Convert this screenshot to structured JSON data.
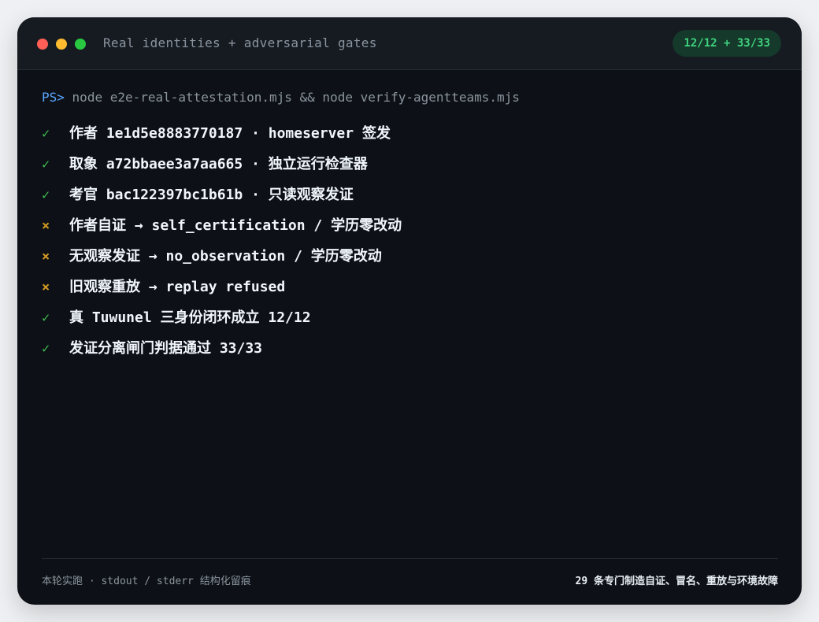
{
  "window": {
    "title": "Real identities + adversarial gates",
    "badge": "12/12 + 33/33"
  },
  "terminal": {
    "prompt": "PS>",
    "command": "node e2e-real-attestation.mjs && node verify-agentteams.mjs",
    "lines": [
      {
        "status": "pass",
        "mark": "✓",
        "text": "作者  1e1d5e8883770187 · homeserver 签发"
      },
      {
        "status": "pass",
        "mark": "✓",
        "text": "取象  a72bbaee3a7aa665 · 独立运行检查器"
      },
      {
        "status": "pass",
        "mark": "✓",
        "text": "考官  bac122397bc1b61b · 只读观察发证"
      },
      {
        "status": "fail",
        "mark": "×",
        "text": "作者自证 → self_certification / 学历零改动"
      },
      {
        "status": "fail",
        "mark": "×",
        "text": "无观察发证 → no_observation / 学历零改动"
      },
      {
        "status": "fail",
        "mark": "×",
        "text": "旧观察重放 → replay refused"
      },
      {
        "status": "pass",
        "mark": "✓",
        "text": "真 Tuwunel 三身份闭环成立 12/12"
      },
      {
        "status": "pass",
        "mark": "✓",
        "text": "发证分离闸门判据通过 33/33"
      }
    ]
  },
  "footer": {
    "left": "本轮实跑 · stdout / stderr 结构化留痕",
    "right": "29 条专门制造自证、冒名、重放与环境故障"
  },
  "colors": {
    "background": "#0d1117",
    "pass": "#3fb950",
    "fail": "#d29922",
    "prompt": "#58a6ff",
    "badge_bg": "#15392a",
    "badge_fg": "#3fd27f"
  }
}
